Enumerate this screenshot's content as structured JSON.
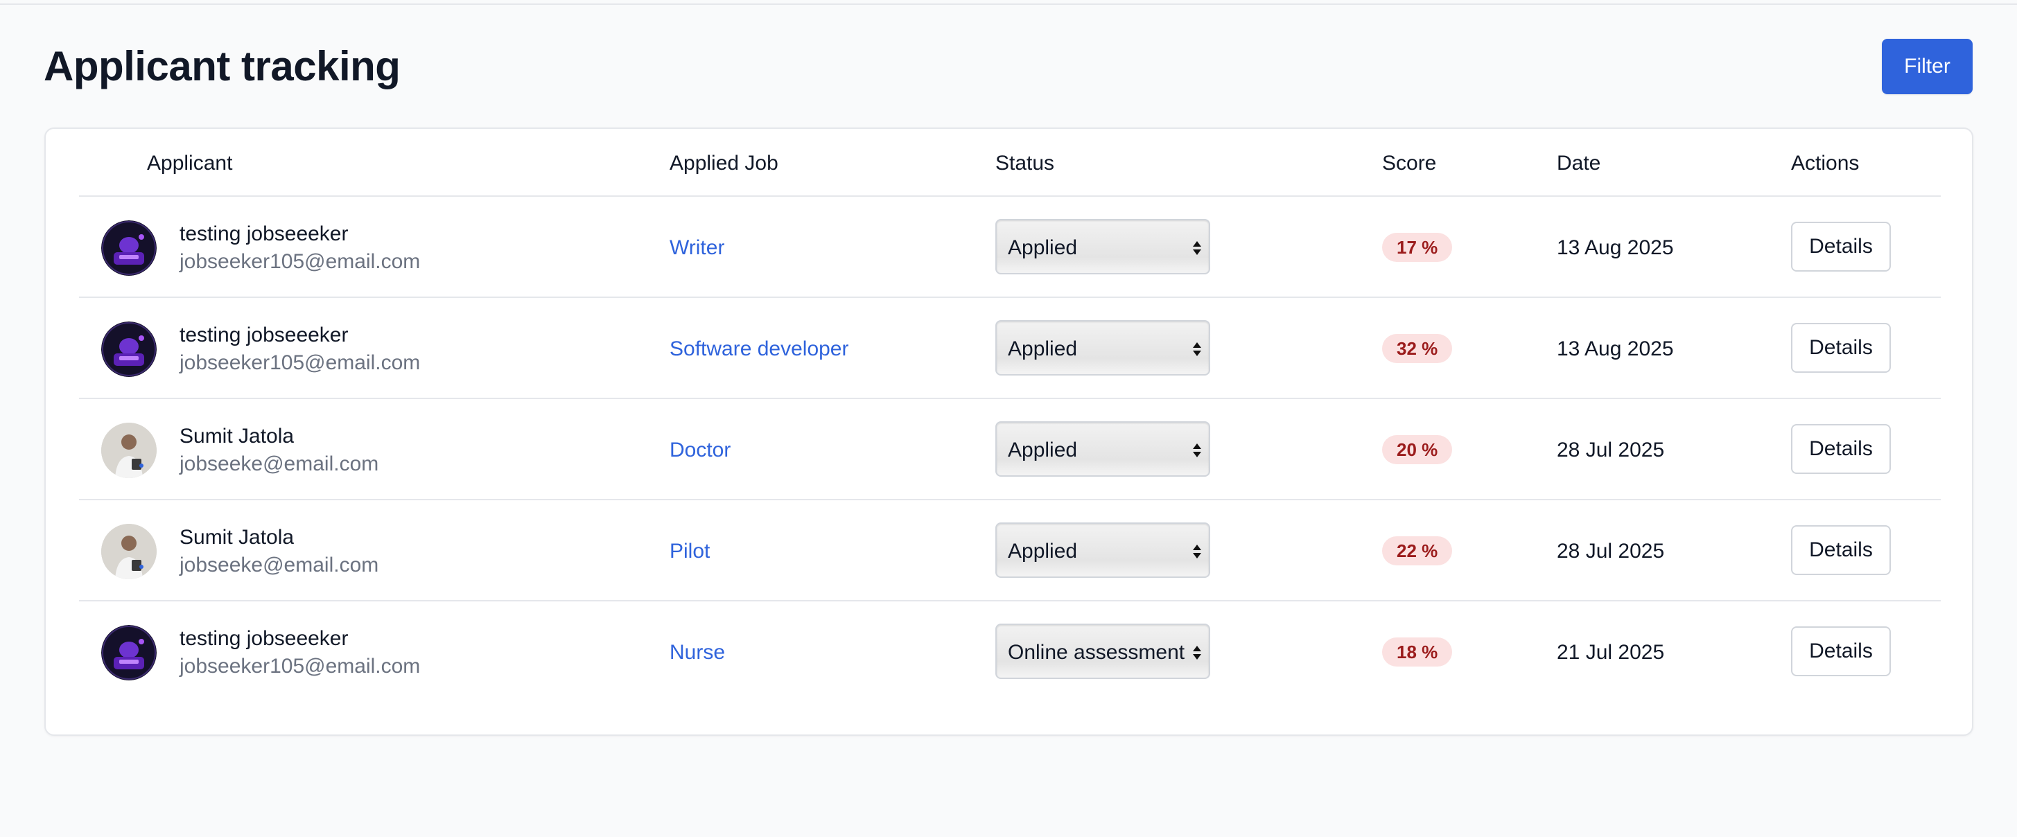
{
  "page": {
    "title": "Applicant tracking",
    "filter_label": "Filter"
  },
  "table": {
    "headers": {
      "applicant": "Applicant",
      "applied_job": "Applied Job",
      "status": "Status",
      "score": "Score",
      "date": "Date",
      "actions": "Actions"
    },
    "rows": [
      {
        "name": "testing jobseeeker",
        "email": "jobseeker105@email.com",
        "job": "Writer",
        "status": "Applied",
        "score": "17 %",
        "date": "13 Aug 2025",
        "action": "Details",
        "avatar": "dark-neon-avatar"
      },
      {
        "name": "testing jobseeeker",
        "email": "jobseeker105@email.com",
        "job": "Software developer",
        "status": "Applied",
        "score": "32 %",
        "date": "13 Aug 2025",
        "action": "Details",
        "avatar": "dark-neon-avatar"
      },
      {
        "name": "Sumit Jatola",
        "email": "jobseeke@email.com",
        "job": "Doctor",
        "status": "Applied",
        "score": "20 %",
        "date": "28 Jul 2025",
        "action": "Details",
        "avatar": "photo-avatar"
      },
      {
        "name": "Sumit Jatola",
        "email": "jobseeke@email.com",
        "job": "Pilot",
        "status": "Applied",
        "score": "22 %",
        "date": "28 Jul 2025",
        "action": "Details",
        "avatar": "photo-avatar"
      },
      {
        "name": "testing jobseeeker",
        "email": "jobseeker105@email.com",
        "job": "Nurse",
        "status": "Online assessment",
        "score": "18 %",
        "date": "21 Jul 2025",
        "action": "Details",
        "avatar": "dark-neon-avatar"
      }
    ]
  },
  "colors": {
    "accent": "#2f63dc",
    "score_badge_bg": "#fbe1e1",
    "score_badge_text": "#9b1c1c",
    "page_bg": "#f9fafb"
  }
}
